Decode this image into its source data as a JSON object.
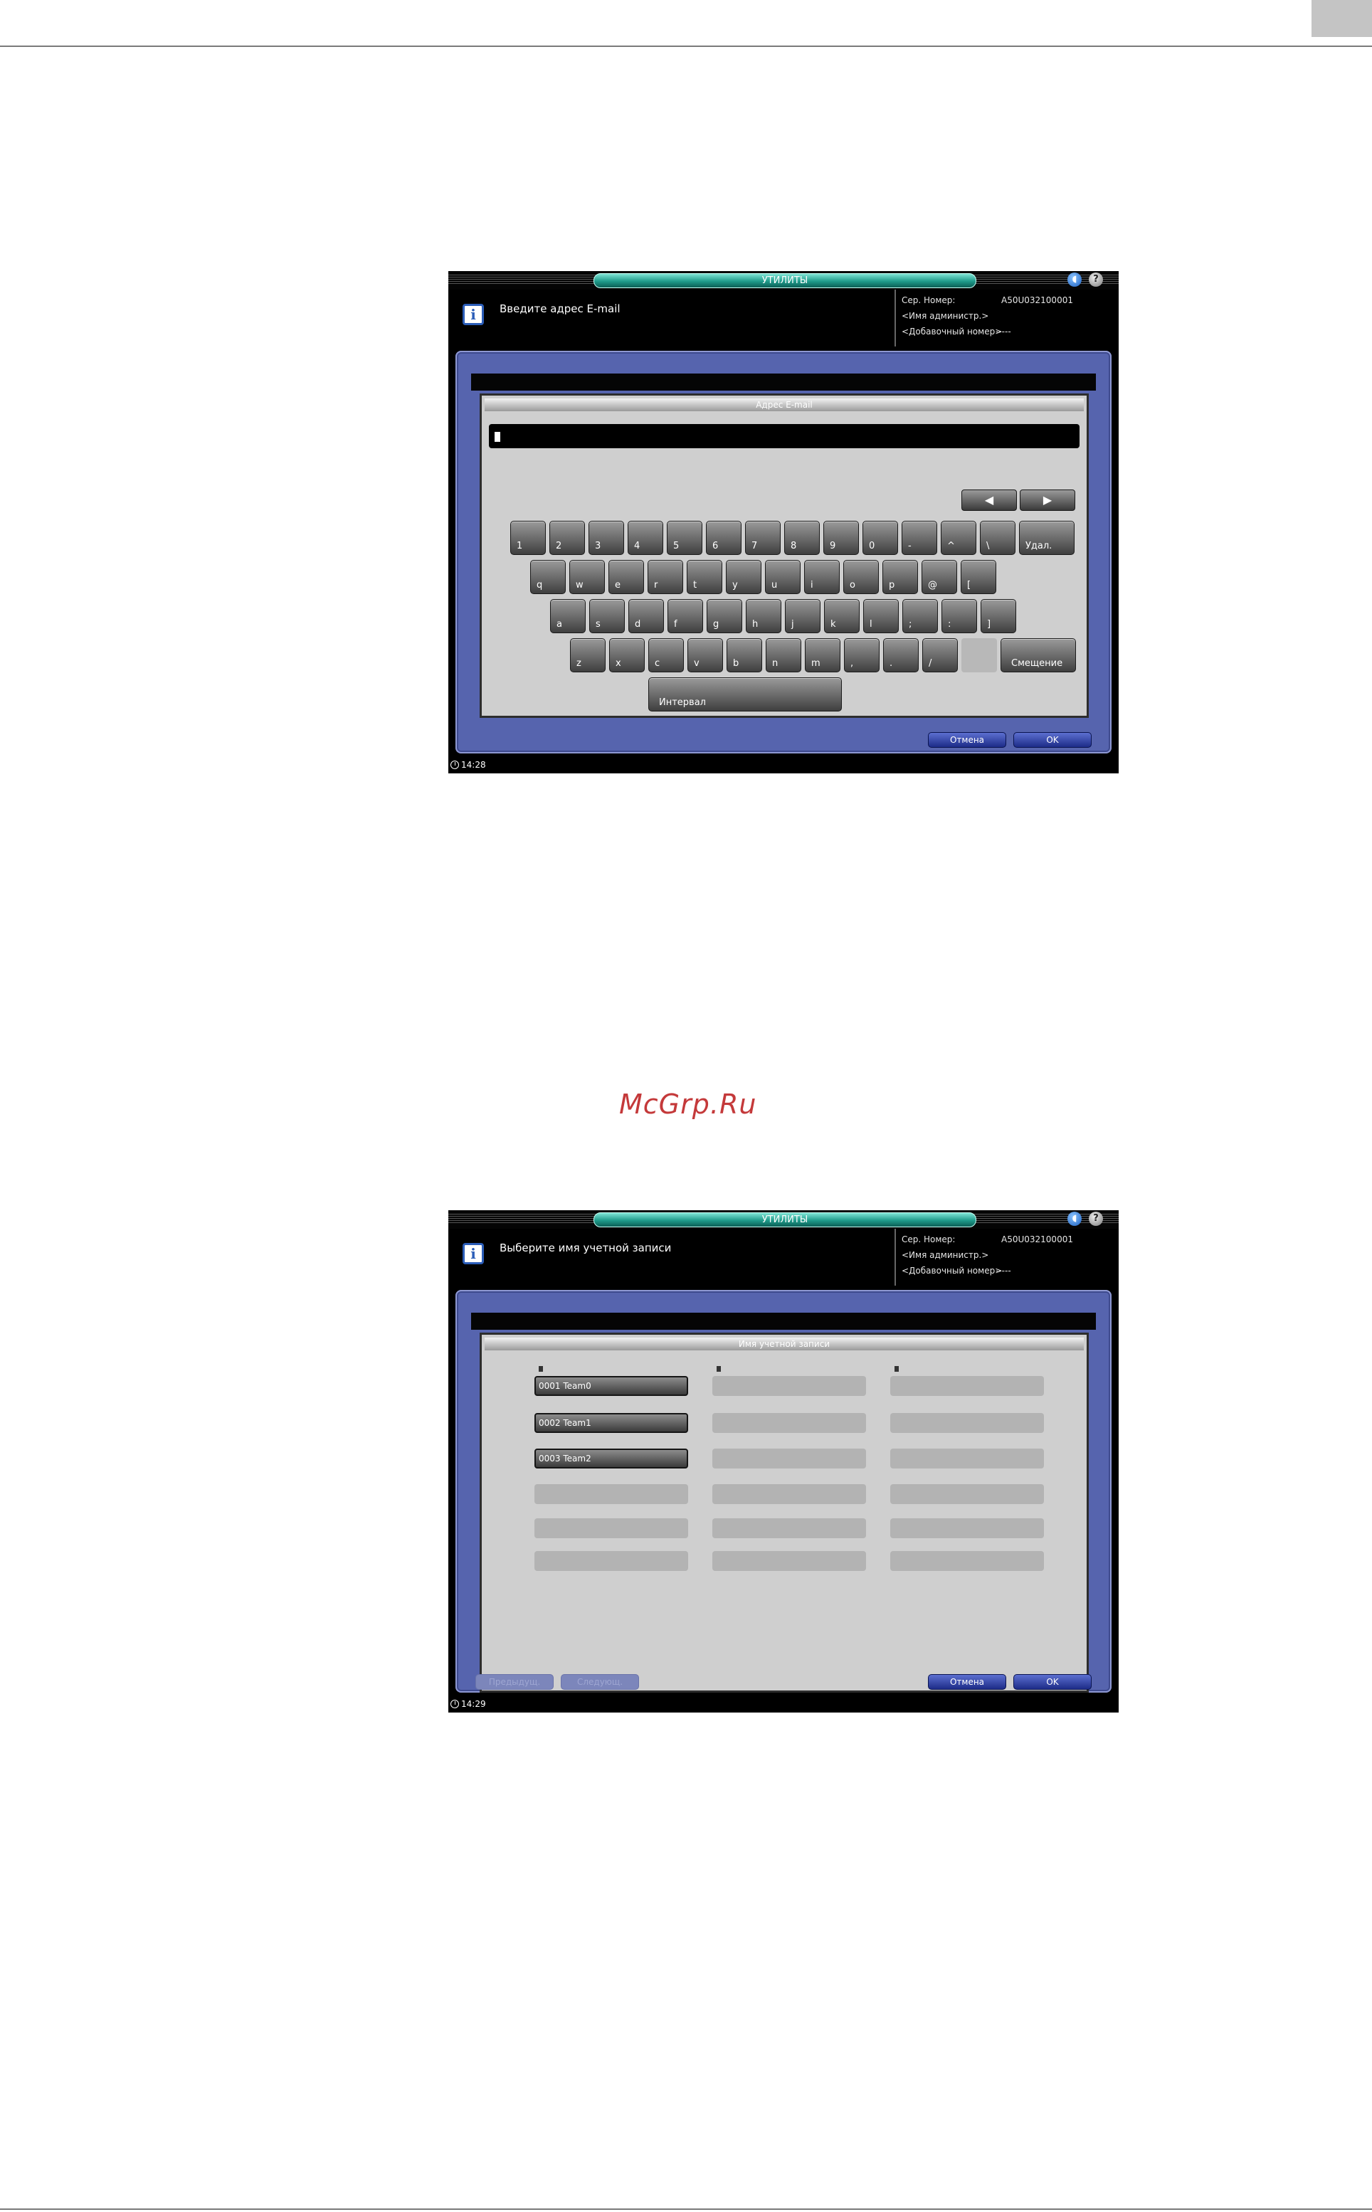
{
  "screen1": {
    "title": "УТИЛИТЫ",
    "message": "Введите адрес E-mail",
    "status": {
      "serial_label": "Сер. Номер:",
      "serial_value": "A50U032100001",
      "admin_name": "<Имя администр.>",
      "ext_label": "<Добавочный номер>",
      "ext_value": "-----"
    },
    "panel_title": "Адрес E-mail",
    "input_value": "",
    "arrow_left": "◀",
    "arrow_right": "▶",
    "keys_row1": [
      "1",
      "2",
      "3",
      "4",
      "5",
      "6",
      "7",
      "8",
      "9",
      "0",
      "-",
      "^",
      "\\"
    ],
    "delete_label": "Удал.",
    "keys_row2": [
      "q",
      "w",
      "e",
      "r",
      "t",
      "y",
      "u",
      "i",
      "o",
      "p",
      "@",
      "["
    ],
    "keys_row3": [
      "a",
      "s",
      "d",
      "f",
      "g",
      "h",
      "j",
      "k",
      "l",
      ";",
      ":",
      "]"
    ],
    "keys_row4": [
      "z",
      "x",
      "c",
      "v",
      "b",
      "n",
      "m",
      ",",
      ".",
      "/"
    ],
    "shift_label": "Смещение",
    "space_label": "Интервал",
    "cancel_label": "Отмена",
    "ok_label": "OK",
    "clock": "14:28"
  },
  "watermark": "McGrp.Ru",
  "screen2": {
    "title": "УТИЛИТЫ",
    "message": "Выберите имя учетной записи",
    "status": {
      "serial_label": "Сер. Номер:",
      "serial_value": "A50U032100001",
      "admin_name": "<Имя администр.>",
      "ext_label": "<Добавочный номер>",
      "ext_value": "-----"
    },
    "panel_title": "Имя учетной записи",
    "accounts": [
      "0001 Team0",
      "0002 Team1",
      "0003 Team2"
    ],
    "prev_label": "Предыдущ.",
    "next_label": "Следующ.",
    "cancel_label": "Отмена",
    "ok_label": "OK",
    "clock": "14:29"
  }
}
